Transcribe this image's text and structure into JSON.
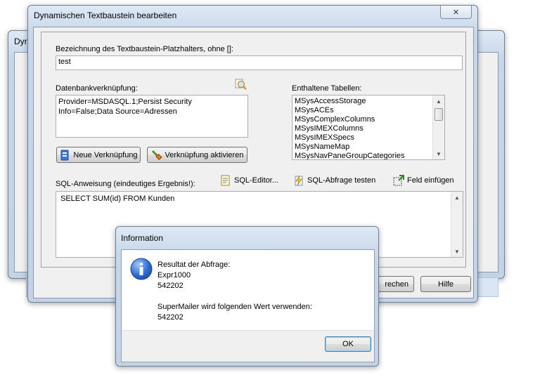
{
  "back_window": {
    "title": "Dyn"
  },
  "main_window": {
    "title": "Dynamischen Textbaustein bearbeiten",
    "close_glyph": "✕",
    "placeholder_label": "Bezeichnung des Textbaustein-Platzhalters, ohne []:",
    "placeholder_value": "test",
    "db_label": "Datenbankverknüpfung:",
    "db_value": "Provider=MSDASQL.1;Persist Security Info=False;Data Source=Adressen",
    "tables_label": "Enthaltene Tabellen:",
    "tables": [
      "MSysAccessStorage",
      "MSysACEs",
      "MSysComplexColumns",
      "MSysIMEXColumns",
      "MSysIMEXSpecs",
      "MSysNameMap",
      "MSysNavPaneGroupCategories"
    ],
    "new_connection": "Neue Verknüpfung",
    "activate_connection": "Verknüpfung aktivieren",
    "sql_label": "SQL-Anweisung (eindeutiges Ergebnis!):",
    "sql_editor": "SQL-Editor...",
    "sql_test": "SQL-Abfrage testen",
    "insert_field": "Feld einfügen",
    "sql_value": "SELECT SUM(id) FROM Kunden",
    "cancel_partial": "rechen",
    "help": "Hilfe"
  },
  "info_dialog": {
    "title": "Information",
    "line1": "Resultat der Abfrage:",
    "line2": "Expr1000",
    "line3": "542202",
    "line4": "SuperMailer wird folgenden Wert verwenden:",
    "line5": "542202",
    "ok": "OK",
    "icon": "information-icon"
  },
  "colors": {
    "accent": "#3b77d8",
    "window_border": "#6f7f95"
  }
}
